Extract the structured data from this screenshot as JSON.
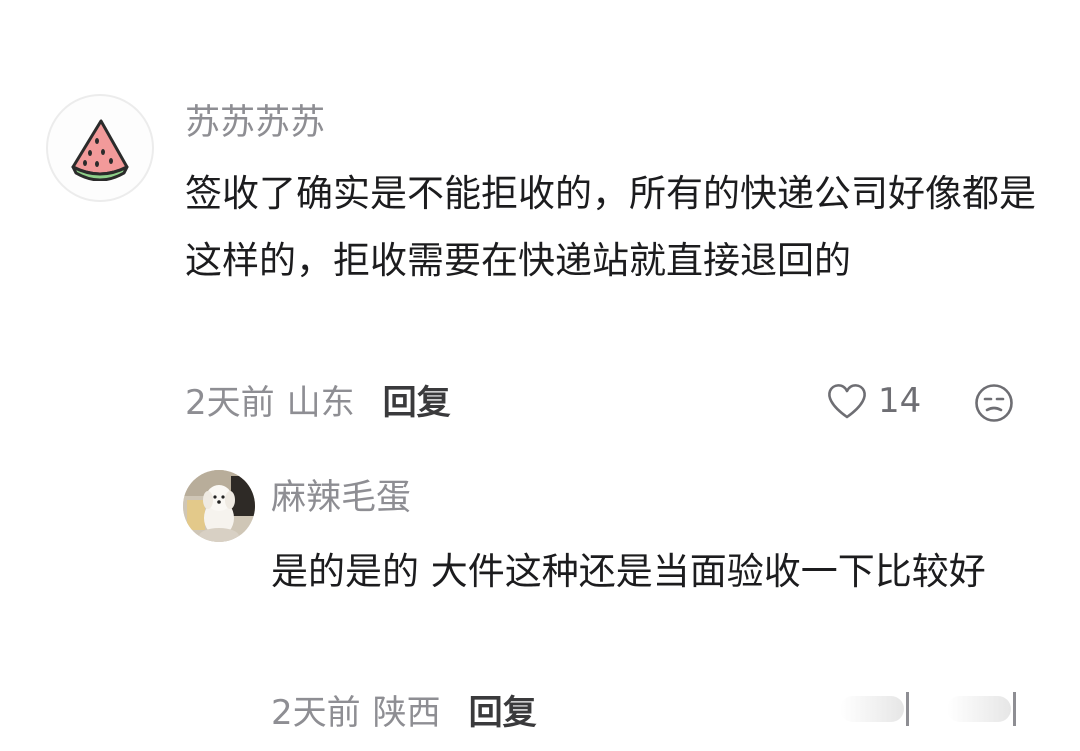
{
  "comments": [
    {
      "avatar": "watermelon-icon",
      "username": "苏苏苏苏",
      "text": "签收了确实是不能拒收的，所有的快递公司好像都是这样的，拒收需要在快递站就直接退回的",
      "time": "2天前",
      "location": "山东",
      "reply_label": "回复",
      "likes": "14",
      "reply": {
        "avatar": "puppy-photo",
        "username": "麻辣毛蛋",
        "text": "是的是的 大件这种还是当面验收一下比较好",
        "time": "2天前",
        "location": "陕西",
        "reply_label": "回复"
      }
    }
  ],
  "colors": {
    "username": "#8e8e93",
    "body_text": "#1c1c1e",
    "meta": "#8e8e93",
    "reply_button": "#3a3a3c"
  }
}
